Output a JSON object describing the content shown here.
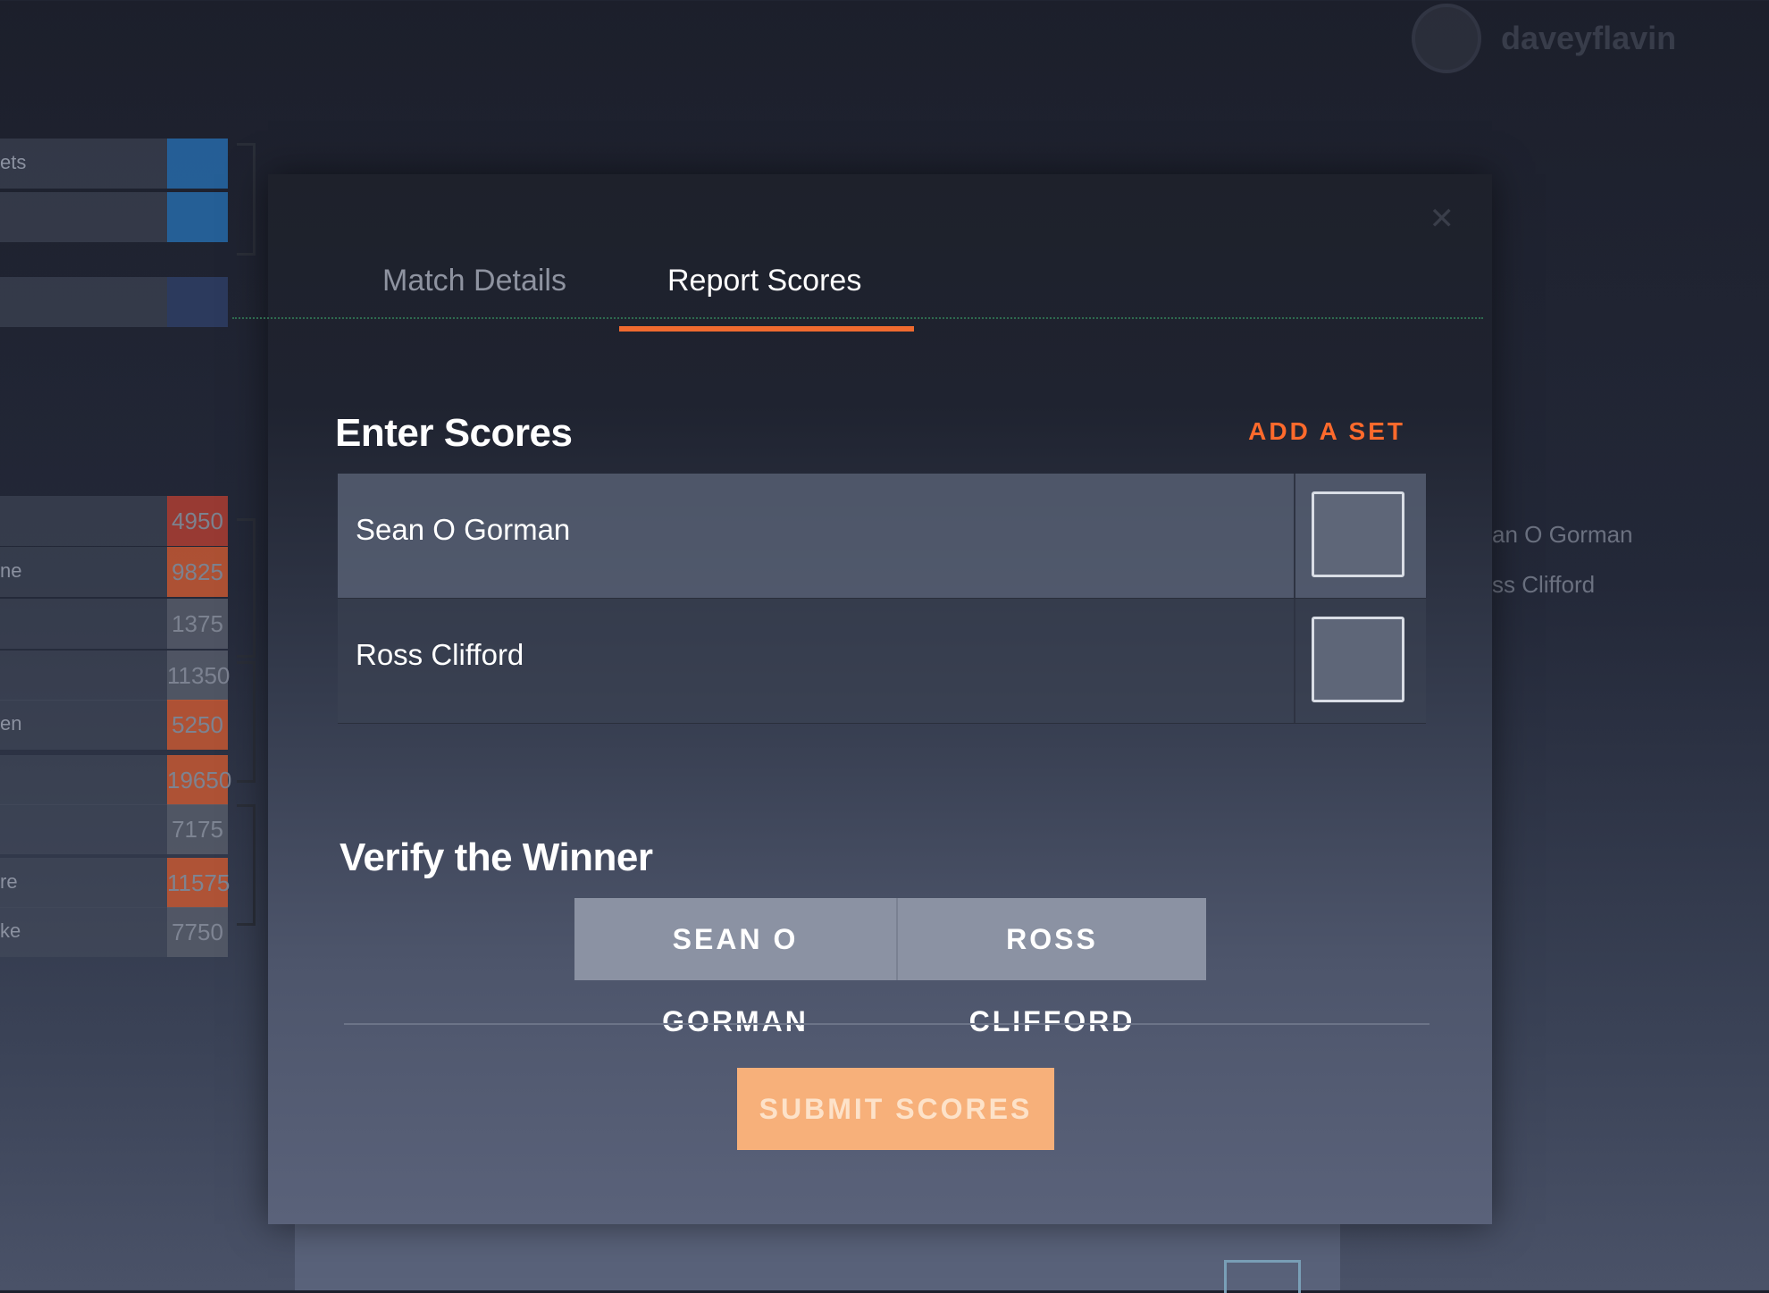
{
  "background": {
    "username": "daveyflavin",
    "bracket": [
      {
        "name": "ets",
        "score": "",
        "color": "#1f6fb8"
      },
      {
        "name": "",
        "score": "",
        "color": "#1f6fb8"
      },
      {
        "name": "",
        "score": "",
        "color": "#2a3a66"
      },
      {
        "name": "",
        "score": "4950",
        "color": "#c23a2a"
      },
      {
        "name": "ne",
        "score": "9825",
        "color": "#e05a2a"
      },
      {
        "name": "",
        "score": "1375",
        "color": "#5a5f6c"
      },
      {
        "name": "",
        "score": "11350",
        "color": "#5a5f6c"
      },
      {
        "name": "en",
        "score": "5250",
        "color": "#e05a2a"
      },
      {
        "name": "",
        "score": "19650",
        "color": "#e05a2a"
      },
      {
        "name": "",
        "score": "7175",
        "color": "#5a5f6c"
      },
      {
        "name": "re",
        "score": "11575",
        "color": "#e05a2a"
      },
      {
        "name": "ke",
        "score": "7750",
        "color": "#5a5f6c"
      }
    ],
    "right_names": [
      "an O Gorman",
      "ss Clifford"
    ]
  },
  "modal": {
    "close_icon": "close-icon",
    "tabs": [
      {
        "label": "Match Details",
        "active": false
      },
      {
        "label": "Report Scores",
        "active": true
      }
    ],
    "enter_scores": {
      "title": "Enter Scores",
      "add_set_label": "ADD A SET",
      "players": [
        {
          "name": "Sean O Gorman",
          "score": ""
        },
        {
          "name": "Ross Clifford",
          "score": ""
        }
      ]
    },
    "verify": {
      "title": "Verify the Winner",
      "options": [
        "SEAN O GORMAN",
        "ROSS CLIFFORD"
      ]
    },
    "submit_label": "SUBMIT SCORES",
    "colors": {
      "accent": "#ef6a2f",
      "submit": "#f7b07a",
      "add_set": "#ff6a2c"
    }
  }
}
